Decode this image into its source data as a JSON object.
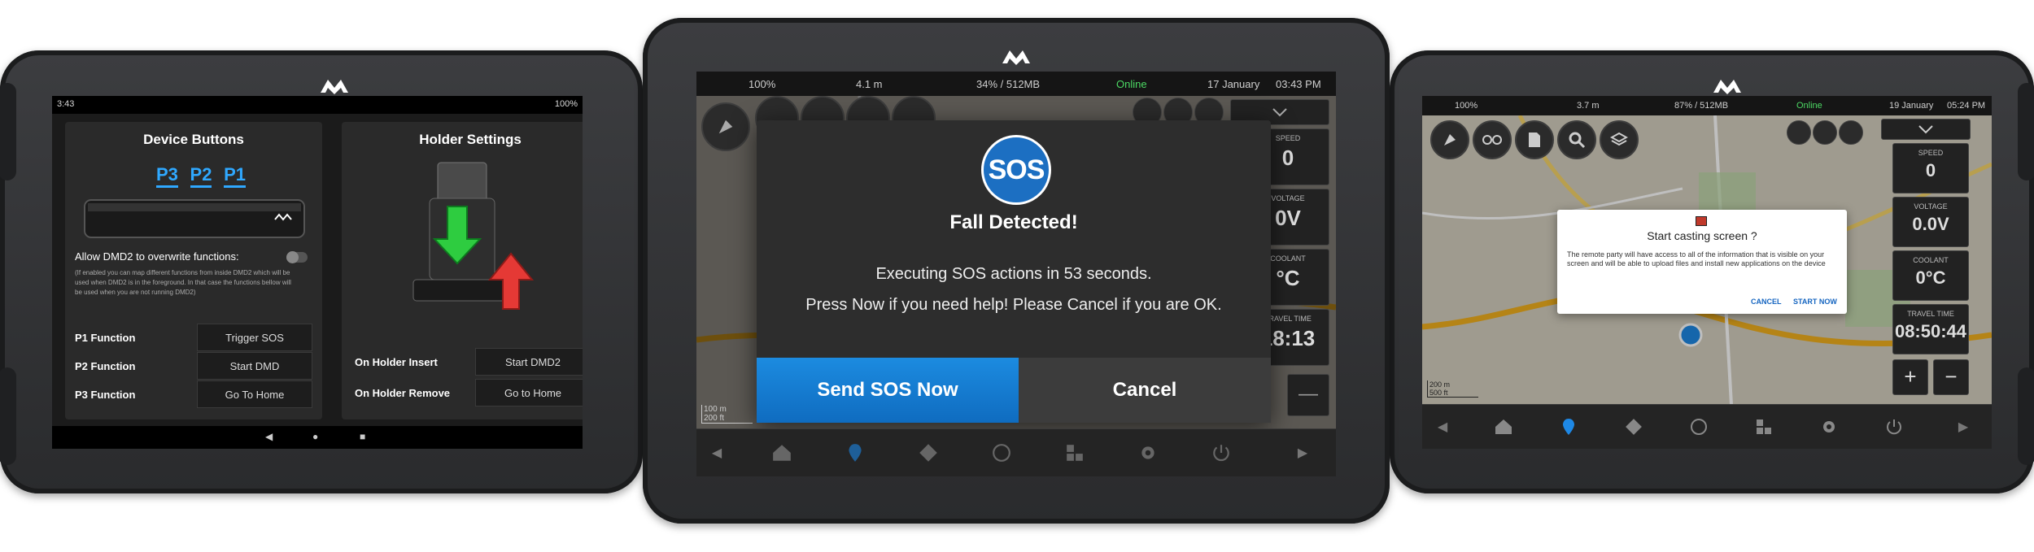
{
  "left_tablet": {
    "statusbar": {
      "time": "3:43",
      "battery": "100%"
    },
    "device_buttons": {
      "title": "Device Buttons",
      "keys": [
        "P3",
        "P2",
        "P1"
      ],
      "allow_label": "Allow DMD2 to overwrite functions:",
      "allow_help": "(If enabled you can map different functions from inside DMD2 which will be used when DMD2 is in the foreground. In that case the functions bellow will be used when you are not running DMD2)",
      "rows": [
        {
          "label": "P1 Function",
          "value": "Trigger SOS"
        },
        {
          "label": "P2 Function",
          "value": "Start DMD"
        },
        {
          "label": "P3 Function",
          "value": "Go To Home"
        }
      ]
    },
    "holder_settings": {
      "title": "Holder Settings",
      "rows": [
        {
          "label": "On Holder Insert",
          "value": "Start DMD2"
        },
        {
          "label": "On Holder Remove",
          "value": "Go to Home"
        }
      ]
    },
    "navbar": {
      "back": "◀",
      "home": "●",
      "recents": "■"
    }
  },
  "center_tablet": {
    "statusbar": {
      "battery": "100%",
      "gps": "4.1 m",
      "memory": "34% / 512MB",
      "network": "Online",
      "date": "17 January",
      "time": "03:43 PM"
    },
    "side_tiles": [
      {
        "label": "SPEED",
        "value": "0"
      },
      {
        "label": "VOLTAGE",
        "value": "0V"
      },
      {
        "label": "COOLANT",
        "value": "°C"
      },
      {
        "label": "TRAVEL TIME",
        "value": "18:13"
      }
    ],
    "scale": {
      "metric": "100 m",
      "imperial": "200 ft"
    },
    "sos_dialog": {
      "badge": "SOS",
      "title": "Fall Detected!",
      "line1": "Executing SOS actions in 53 seconds.",
      "line2": "Press Now if you need help! Please Cancel if you are OK.",
      "send_label": "Send SOS Now",
      "cancel_label": "Cancel"
    },
    "zoom_out": "—",
    "colors": {
      "send": "#1a7fd4",
      "cancel": "#3c3c3c",
      "sos_badge": "#1c6fc2"
    }
  },
  "right_tablet": {
    "statusbar": {
      "battery": "100%",
      "gps": "3.7 m",
      "memory": "87% / 512MB",
      "network": "Online",
      "date": "19 January",
      "time": "05:24 PM"
    },
    "side_tiles": [
      {
        "label": "SPEED",
        "value": "0"
      },
      {
        "label": "VOLTAGE",
        "value": "0.0V"
      },
      {
        "label": "COOLANT",
        "value": "0°C"
      },
      {
        "label": "TRAVEL TIME",
        "value": "08:50:44"
      }
    ],
    "scale": {
      "metric": "200 m",
      "imperial": "500 ft"
    },
    "cast_dialog": {
      "title": "Start casting screen ?",
      "body": "The remote party will have access to all of the information that is visible on your screen and will be able to upload files and install new applications on the device",
      "cancel": "CANCEL",
      "start": "START NOW"
    },
    "zoom_in": "+",
    "zoom_out": "−"
  }
}
